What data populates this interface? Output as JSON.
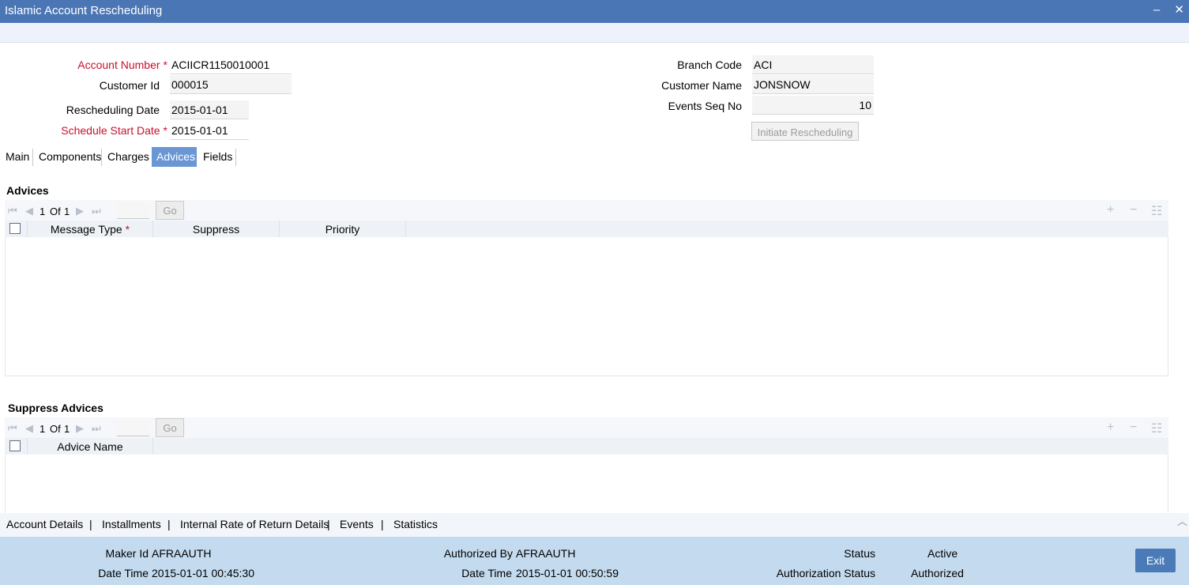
{
  "window": {
    "title": "Islamic Account Rescheduling",
    "minimize_glyph": "–",
    "close_glyph": "✕"
  },
  "form": {
    "account_number": {
      "label": "Account Number",
      "value": "ACIICR1150010001",
      "required": true
    },
    "customer_id": {
      "label": "Customer Id",
      "value": "000015"
    },
    "rescheduling_date": {
      "label": "Rescheduling Date",
      "value": "2015-01-01"
    },
    "schedule_start_date": {
      "label": "Schedule Start Date",
      "value": "2015-01-01",
      "required": true
    },
    "branch_code": {
      "label": "Branch Code",
      "value": "ACI"
    },
    "customer_name": {
      "label": "Customer Name",
      "value": "JONSNOW"
    },
    "events_seq_no": {
      "label": "Events Seq No",
      "value": "10"
    },
    "initiate_button": "Initiate Rescheduling",
    "required_mark": "*"
  },
  "tabs": [
    {
      "label": "Main",
      "active": false
    },
    {
      "label": "Components",
      "active": false
    },
    {
      "label": "Charges",
      "active": false
    },
    {
      "label": "Advices",
      "active": true
    },
    {
      "label": "Fields",
      "active": false
    }
  ],
  "advices": {
    "title": "Advices",
    "pager": {
      "current": "1",
      "of_label": "Of",
      "total": "1",
      "go": "Go"
    },
    "columns": [
      "Message Type",
      "Suppress",
      "Priority"
    ],
    "rows": []
  },
  "suppress_advices": {
    "title": "Suppress Advices",
    "pager": {
      "current": "1",
      "of_label": "Of",
      "total": "1",
      "go": "Go"
    },
    "columns": [
      "Advice Name"
    ],
    "rows": []
  },
  "bottom_links": [
    "Account Details",
    "Installments",
    "Internal Rate of Return Details",
    "Events",
    "Statistics"
  ],
  "link_separator": "|",
  "footer": {
    "maker_id_label": "Maker Id",
    "maker_id": "AFRAAUTH",
    "maker_datetime_label": "Date Time",
    "maker_datetime": "2015-01-01 00:45:30",
    "authorized_by_label": "Authorized By",
    "authorized_by": "AFRAAUTH",
    "auth_datetime_label": "Date Time",
    "auth_datetime": "2015-01-01 00:50:59",
    "status_label": "Status",
    "status": "Active",
    "auth_status_label": "Authorization Status",
    "auth_status": "Authorized",
    "exit_label": "Exit"
  },
  "colors": {
    "titlebar": "#4a76b6",
    "active_tab": "#6a96d4",
    "footer": "#c4dbef",
    "required": "#c8102e"
  }
}
